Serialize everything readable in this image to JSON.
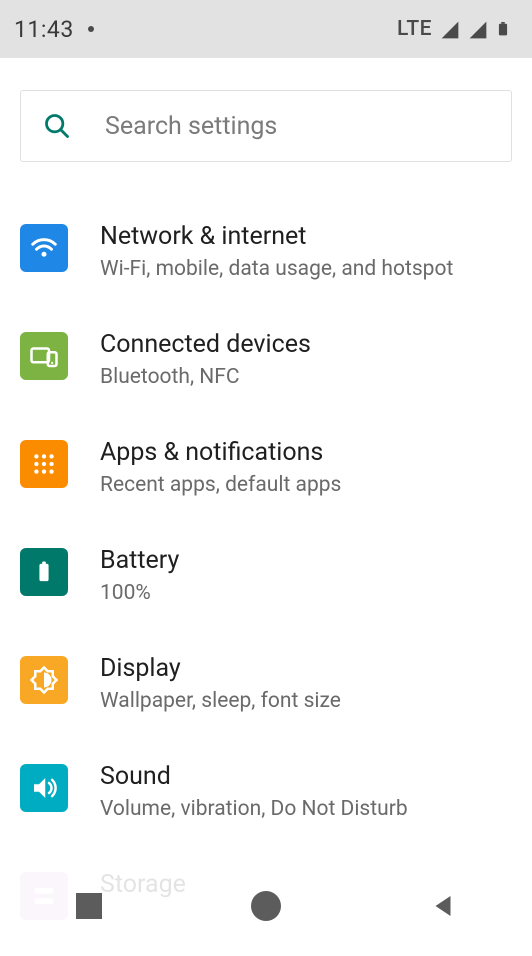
{
  "statusbar": {
    "time": "11:43",
    "network_label": "LTE"
  },
  "search": {
    "placeholder": "Search settings"
  },
  "settings": [
    {
      "key": "network",
      "icon": "wifi-icon",
      "color": "bg-blue",
      "title": "Network & internet",
      "subtitle": "Wi-Fi, mobile, data usage, and hotspot"
    },
    {
      "key": "devices",
      "icon": "devices-icon",
      "color": "bg-green",
      "title": "Connected devices",
      "subtitle": "Bluetooth, NFC"
    },
    {
      "key": "apps",
      "icon": "apps-icon",
      "color": "bg-orange",
      "title": "Apps & notifications",
      "subtitle": "Recent apps, default apps"
    },
    {
      "key": "battery",
      "icon": "battery-icon",
      "color": "bg-teal",
      "title": "Battery",
      "subtitle": "100%"
    },
    {
      "key": "display",
      "icon": "display-icon",
      "color": "bg-amber",
      "title": "Display",
      "subtitle": "Wallpaper, sleep, font size"
    },
    {
      "key": "sound",
      "icon": "sound-icon",
      "color": "bg-cyan",
      "title": "Sound",
      "subtitle": "Volume, vibration, Do Not Disturb"
    },
    {
      "key": "storage",
      "icon": "storage-icon",
      "color": "bg-purple",
      "title": "Storage",
      "subtitle": ""
    }
  ]
}
